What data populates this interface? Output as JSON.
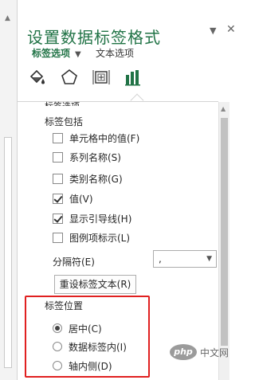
{
  "pane": {
    "title": "设置数据标签格式",
    "tab_active": "标签选项",
    "tab_other": "文本选项"
  },
  "icons": [
    "fill-line-icon",
    "effects-pentagon-icon",
    "size-properties-icon",
    "label-options-bar-chart-icon"
  ],
  "section_clipped": "标签选项",
  "label_contains": {
    "heading": "标签包括",
    "options": [
      {
        "label": "单元格中的值(F)",
        "checked": false
      },
      {
        "label": "系列名称(S)",
        "checked": false
      },
      {
        "label": "类别名称(G)",
        "checked": false
      },
      {
        "label": "值(V)",
        "checked": true
      },
      {
        "label": "显示引导线(H)",
        "checked": true
      },
      {
        "label": "图例项标示(L)",
        "checked": false
      }
    ]
  },
  "separator": {
    "label": "分隔符(E)",
    "value": ","
  },
  "reset_button": "重设标签文本(R)",
  "label_position": {
    "heading": "标签位置",
    "options": [
      {
        "label": "居中(C)",
        "selected": true
      },
      {
        "label": "数据标签内(I)",
        "selected": false
      },
      {
        "label": "轴内侧(D)",
        "selected": false
      }
    ]
  },
  "watermark": {
    "logo": "php",
    "text": "中文网"
  },
  "colors": {
    "accent": "#217346",
    "highlight": "#e02020"
  }
}
